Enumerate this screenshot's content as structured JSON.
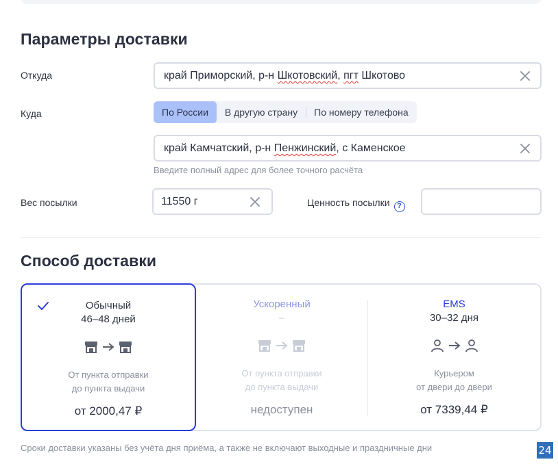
{
  "section_params": {
    "title": "Параметры доставки",
    "from": {
      "label": "Откуда",
      "value_parts": [
        "край Приморский, р-н ",
        "Шкотовский",
        ", ",
        "пгт",
        " Шкотово"
      ]
    },
    "to": {
      "label": "Куда",
      "tabs": [
        "По России",
        "В другую страну",
        "По номеру телефона"
      ],
      "active_tab": 0,
      "value_parts": [
        "край Камчатский, р-н ",
        "Пенжинский",
        ", с Каменское"
      ],
      "hint": "Введите полный адрес для более точного расчёта"
    },
    "weight": {
      "label": "Вес посылки",
      "value": "11550 г"
    },
    "declared_value": {
      "label": "Ценность посылки",
      "help_icon": "?",
      "value": ""
    }
  },
  "section_method": {
    "title": "Способ доставки",
    "options": [
      {
        "name": "Обычный",
        "days": "46–48 дней",
        "icon": "pickup-point-to-pickup-point",
        "desc_line1": "От пункта отправки",
        "desc_line2": "до пункта выдачи",
        "price": "от 2000,47 ₽",
        "selected": true
      },
      {
        "name": "Ускоренный",
        "days": "–",
        "icon": "pickup-point-to-pickup-point",
        "desc_line1": "От пункта отправки",
        "desc_line2": "до пункта выдачи",
        "price": "недоступен",
        "disabled": true
      },
      {
        "name": "EMS",
        "days": "30–32 дня",
        "icon": "person-to-person",
        "desc_line1": "Курьером",
        "desc_line2": "от двери до двери",
        "price": "от 7339,44 ₽"
      }
    ]
  },
  "footnote": "Сроки доставки указаны без учёта дня приёма, а также не включают выходные и праздничные дни",
  "badge": "24",
  "colors": {
    "accent": "#2a3ed9",
    "tab_active": "#aac0f8",
    "border": "#d9dce6",
    "muted_text": "#8a8f9c",
    "error_underline": "#e0362c"
  }
}
